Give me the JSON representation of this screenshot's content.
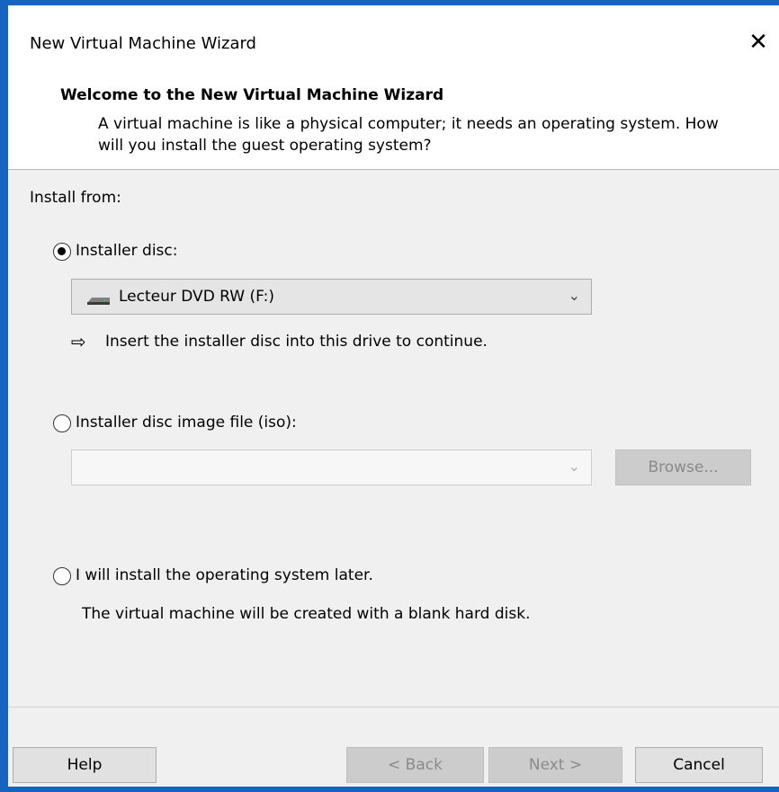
{
  "window": {
    "title": "New Virtual Machine Wizard",
    "close_glyph": "✕"
  },
  "header": {
    "title": "Welcome to the New Virtual Machine Wizard",
    "description": "A virtual machine is like a physical computer; it needs an operating system. How will you install the guest operating system?"
  },
  "install": {
    "label": "Install from:",
    "options": [
      {
        "label": "Installer disc:",
        "selected": true
      },
      {
        "label": "Installer disc image file (iso):",
        "selected": false
      },
      {
        "label": "I will install the operating system later.",
        "selected": false
      }
    ],
    "disc_drive": {
      "value": "Lecteur DVD RW (F:)",
      "icon": "dvd-drive-icon"
    },
    "disc_hint_arrow": "⇨",
    "disc_hint": "Insert the installer disc into this drive to continue.",
    "iso_path": "",
    "browse_label": "Browse...",
    "later_hint": "The virtual machine will be created with a blank hard disk."
  },
  "footer": {
    "help": "Help",
    "back": "< Back",
    "next": "Next >",
    "cancel": "Cancel"
  },
  "colors": {
    "accent_background": "#1565c0",
    "dialog_body": "#f0f0f0",
    "disabled_button": "#cccccc"
  }
}
